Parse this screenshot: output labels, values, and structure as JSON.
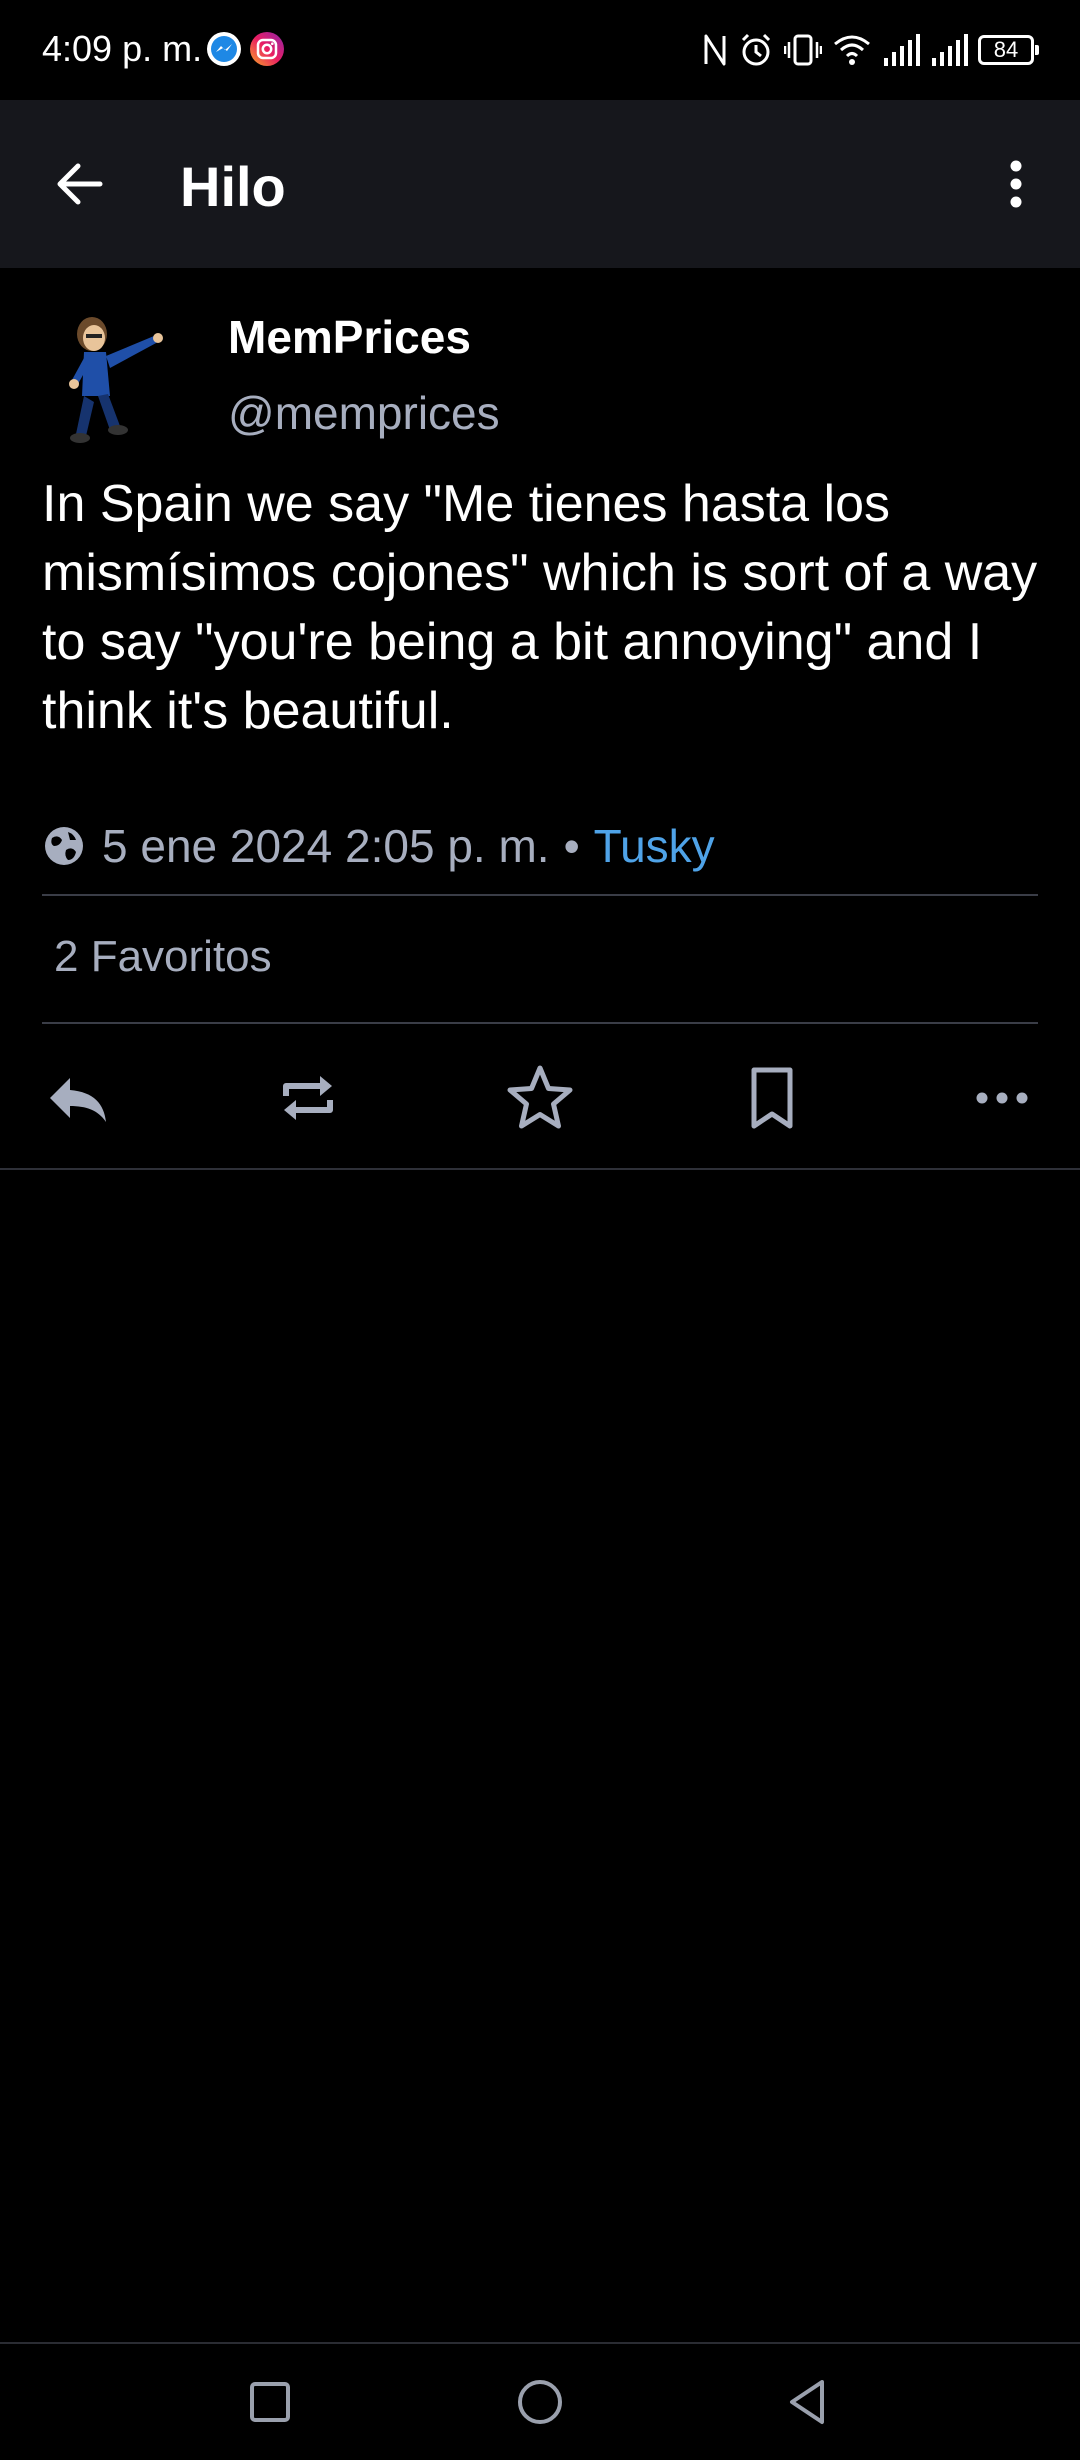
{
  "status_bar": {
    "time": "4:09 p. m.",
    "battery": "84",
    "icons": [
      "messenger-icon",
      "instagram-icon",
      "nfc-icon",
      "alarm-icon",
      "vibrate-icon",
      "wifi-icon",
      "signal-icon",
      "signal-icon",
      "battery-icon"
    ]
  },
  "toolbar": {
    "title": "Hilo",
    "back_icon": "arrow-back-icon",
    "menu_icon": "more-vert-icon"
  },
  "status": {
    "display_name": "MemPrices",
    "username": "@memprices",
    "content": "In Spain we say \"Me tienes hasta los mismísimos cojones\" which is sort of a way to say \"you're being a bit annoying\" and I think it's beautiful.",
    "visibility_icon": "globe-icon",
    "timestamp": "5 ene 2024 2:05 p. m.",
    "separator": "•",
    "application": "Tusky",
    "favourites": "2 Favoritos"
  },
  "actions": [
    {
      "name": "reply",
      "icon": "reply-icon"
    },
    {
      "name": "boost",
      "icon": "repeat-icon"
    },
    {
      "name": "favourite",
      "icon": "star-icon"
    },
    {
      "name": "bookmark",
      "icon": "bookmark-icon"
    },
    {
      "name": "more",
      "icon": "more-horiz-icon"
    }
  ],
  "colors": {
    "background": "#000000",
    "toolbar": "#16171c",
    "text_primary": "#ffffff",
    "text_secondary": "#a7aebf",
    "link": "#4fa3e8",
    "divider": "#3a3d47"
  },
  "nav_bar": {
    "buttons": [
      "recents-square-icon",
      "home-circle-icon",
      "back-triangle-icon"
    ]
  }
}
